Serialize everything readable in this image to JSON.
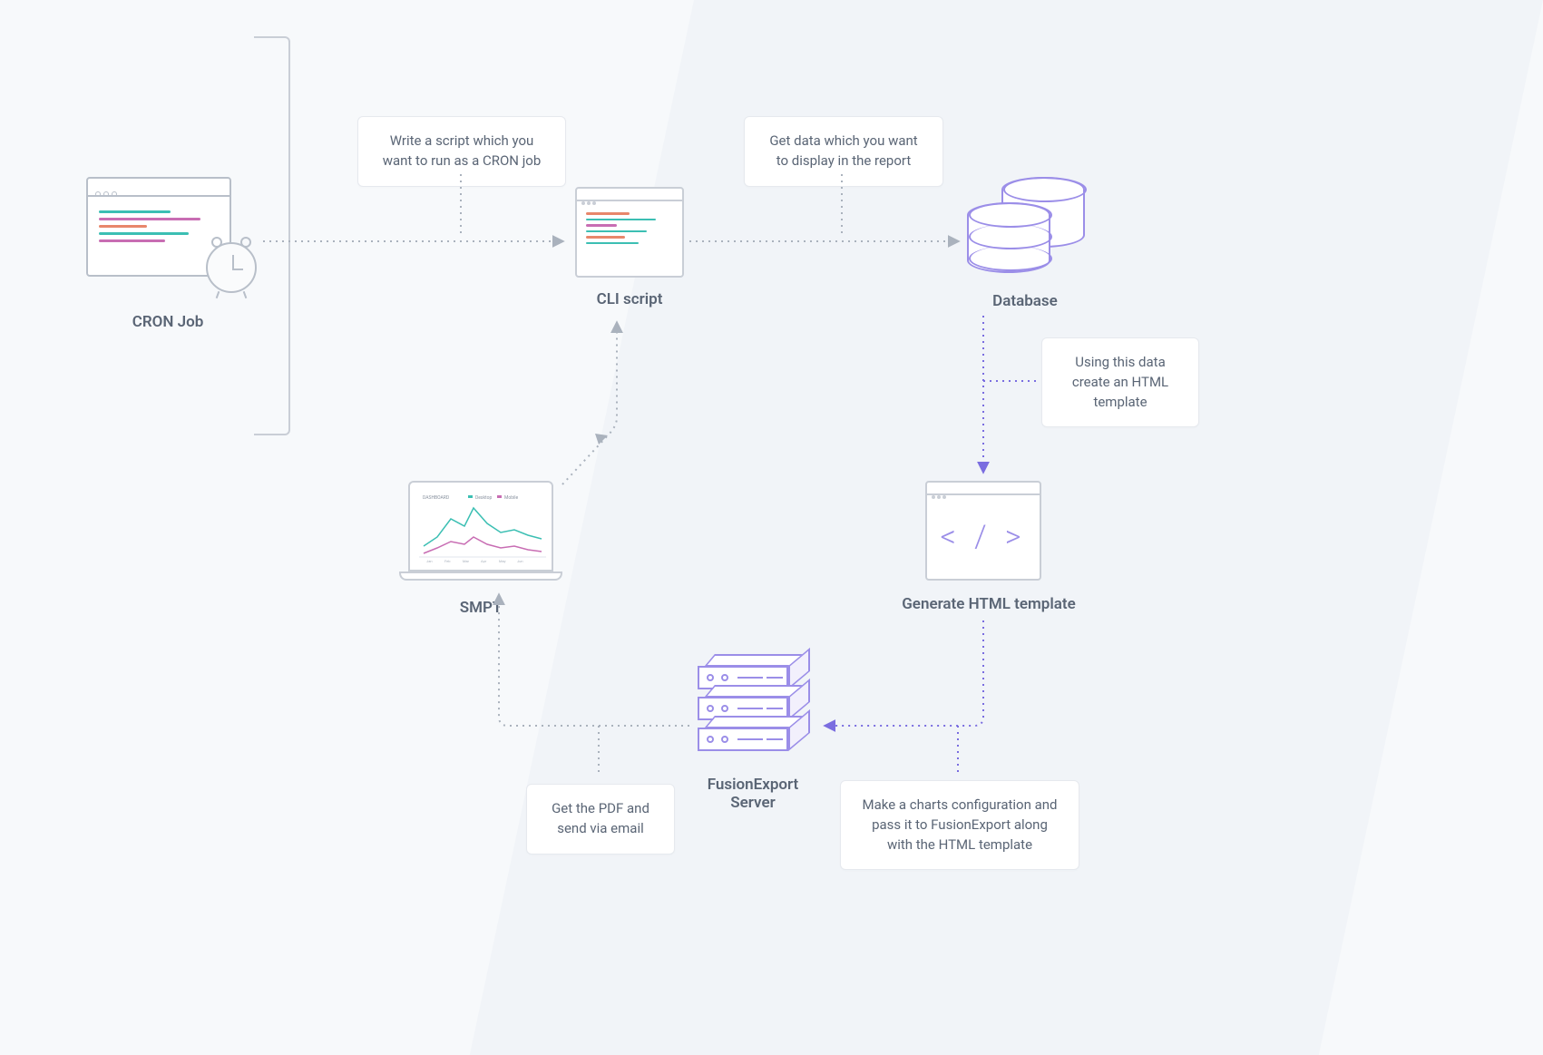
{
  "nodes": {
    "cron": {
      "label": "CRON Job"
    },
    "cli": {
      "label": "CLI script"
    },
    "database": {
      "label": "Database"
    },
    "html_template": {
      "label": "Generate HTML template",
      "glyph": "< / >"
    },
    "fusionexport": {
      "label_line1": "FusionExport",
      "label_line2": "Server"
    },
    "smpt": {
      "label": "SMPT"
    }
  },
  "callouts": {
    "write_script": "Write a script which you want to run as a CRON job",
    "get_data": "Get data which you want to display in the report",
    "using_data": "Using this data create an HTML template",
    "make_charts": "Make a charts configuration and pass it to FusionExport along with the HTML template",
    "get_pdf": "Get the PDF and send via email"
  },
  "colors": {
    "text": "#5a6575",
    "border_grey": "#c9ced6",
    "accent_purple": "#9b8ee8",
    "accent_teal": "#3cbfb3",
    "accent_orange": "#e8866b",
    "accent_magenta": "#c86db3"
  }
}
